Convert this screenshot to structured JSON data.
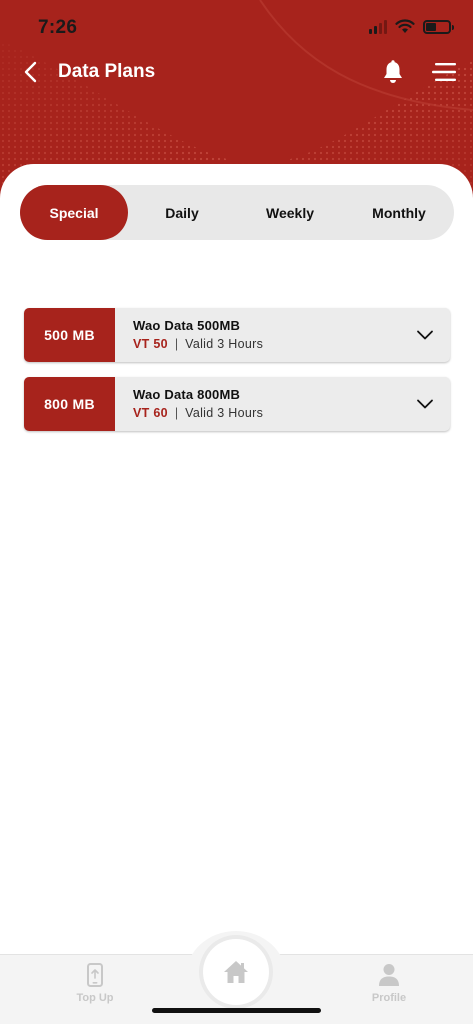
{
  "status": {
    "time": "7:26"
  },
  "header": {
    "title": "Data Plans"
  },
  "tabs": [
    {
      "label": "Special",
      "active": true
    },
    {
      "label": "Daily",
      "active": false
    },
    {
      "label": "Weekly",
      "active": false
    },
    {
      "label": "Monthly",
      "active": false
    }
  ],
  "plans": [
    {
      "size": "500 MB",
      "name": "Wao Data 500MB",
      "price": "VT 50",
      "separator": "|",
      "validity": "Valid 3 Hours"
    },
    {
      "size": "800 MB",
      "name": "Wao Data 800MB",
      "price": "VT 60",
      "separator": "|",
      "validity": "Valid 3 Hours"
    }
  ],
  "bottom_nav": {
    "left_label": "Top Up",
    "right_label": "Profile"
  },
  "colors": {
    "brand": "#a7231c",
    "card": "#ececec",
    "tab_track": "#e8e8e8"
  },
  "icons": {
    "back": "chevron-left-icon",
    "bell": "bell-icon",
    "menu": "menu-icon",
    "chevron": "chevron-down-icon",
    "top_up": "phone-topup-icon",
    "home": "home-icon",
    "profile": "person-icon"
  }
}
